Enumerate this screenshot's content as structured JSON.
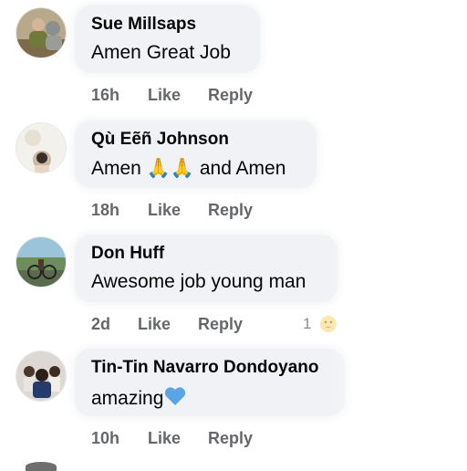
{
  "comments": [
    {
      "author": "Sue Millsaps",
      "text": "Amen  Great Job",
      "time": "16h",
      "like_label": "Like",
      "reply_label": "Reply"
    },
    {
      "author": "Qù Eẽñ Johnson",
      "text_before": "Amen ",
      "emoji": "🙏🙏",
      "text_after": " and Amen",
      "time": "18h",
      "like_label": "Like",
      "reply_label": "Reply"
    },
    {
      "author": "Don Huff",
      "text": "Awesome job young man",
      "time": "2d",
      "like_label": "Like",
      "reply_label": "Reply",
      "reaction_count": "1",
      "reaction_icon": "care-reaction-icon"
    },
    {
      "author": "Tin-Tin Navarro Dondoyano",
      "text": "amazing",
      "emoji_icon": "blue-heart-icon",
      "time": "10h",
      "like_label": "Like",
      "reply_label": "Reply"
    }
  ],
  "colors": {
    "bubble": "#f0f2f5",
    "meta_text": "#65676b",
    "heart": "#5ba4e6"
  }
}
